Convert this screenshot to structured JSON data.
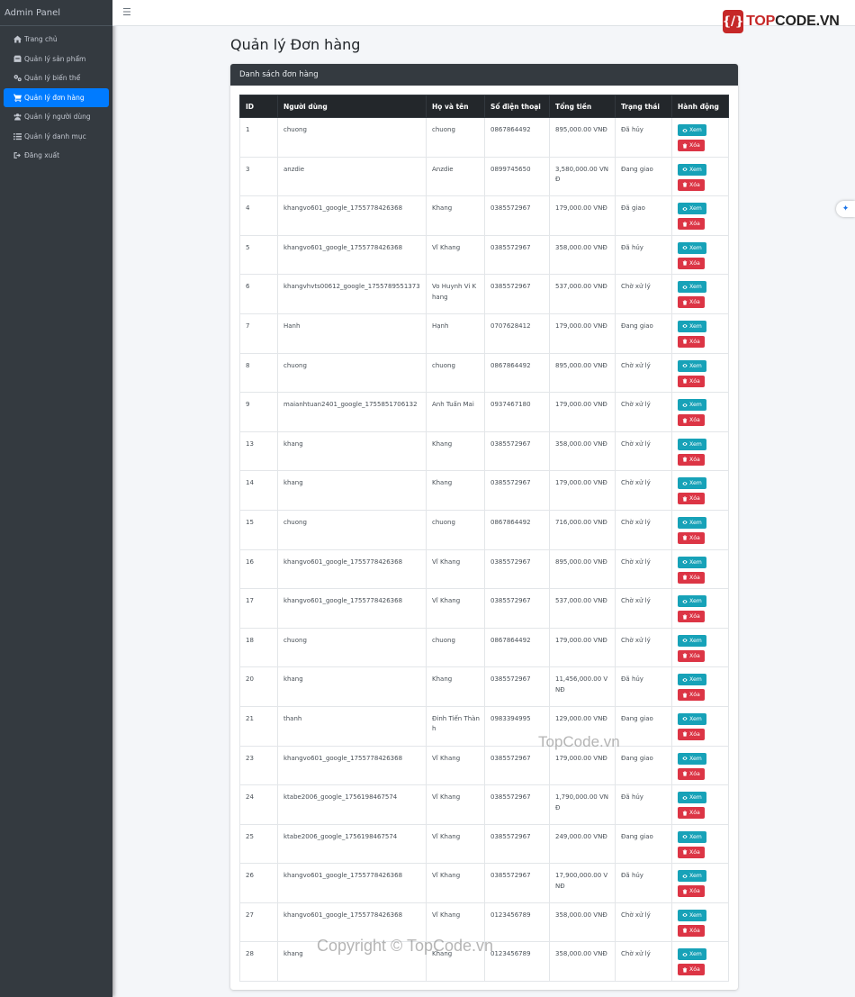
{
  "sidebar": {
    "brand": "Admin Panel",
    "items": [
      {
        "label": "Trang chủ",
        "icon": "home-icon"
      },
      {
        "label": "Quản lý sản phẩm",
        "icon": "box-icon"
      },
      {
        "label": "Quản lý biến thể",
        "icon": "cogs-icon"
      },
      {
        "label": "Quản lý đơn hàng",
        "icon": "cart-icon",
        "active": true
      },
      {
        "label": "Quản lý người dùng",
        "icon": "users-icon"
      },
      {
        "label": "Quản lý danh mục",
        "icon": "list-icon"
      },
      {
        "label": "Đăng xuất",
        "icon": "logout-icon"
      }
    ]
  },
  "topbar": {
    "logo_text_1": "TOP",
    "logo_text_2": "CODE.VN"
  },
  "page": {
    "title": "Quản lý Đơn hàng"
  },
  "card": {
    "header": "Danh sách đơn hàng"
  },
  "table": {
    "columns": [
      "ID",
      "Người dùng",
      "Họ và tên",
      "Số điện thoại",
      "Tổng tiền",
      "Trạng thái",
      "Hành động"
    ],
    "view_label": "Xem",
    "delete_label": "Xóa",
    "rows": [
      [
        "1",
        "chuong",
        "chuong",
        "0867864492",
        "895,000.00 VNĐ",
        "Đã hủy"
      ],
      [
        "3",
        "anzdie",
        "Anzdie",
        "0899745650",
        "3,580,000.00 VNĐ",
        "Đang giao"
      ],
      [
        "4",
        "khangvo601_google_1755778426368",
        "Khang",
        "0385572967",
        "179,000.00 VNĐ",
        "Đã giao"
      ],
      [
        "5",
        "khangvo601_google_1755778426368",
        "Vĩ Khang",
        "0385572967",
        "358,000.00 VNĐ",
        "Đã hủy"
      ],
      [
        "6",
        "khangvhvts00612_google_1755789551373",
        "Vo Huynh Vi Khang",
        "0385572967",
        "537,000.00 VNĐ",
        "Chờ xử lý"
      ],
      [
        "7",
        "Hanh",
        "Hạnh",
        "0707628412",
        "179,000.00 VNĐ",
        "Đang giao"
      ],
      [
        "8",
        "chuong",
        "chuong",
        "0867864492",
        "895,000.00 VNĐ",
        "Chờ xử lý"
      ],
      [
        "9",
        "maianhtuan2401_google_1755851706132",
        "Anh Tuấn Mai",
        "0937467180",
        "179,000.00 VNĐ",
        "Chờ xử lý"
      ],
      [
        "13",
        "khang",
        "Khang",
        "0385572967",
        "358,000.00 VNĐ",
        "Chờ xử lý"
      ],
      [
        "14",
        "khang",
        "Khang",
        "0385572967",
        "179,000.00 VNĐ",
        "Chờ xử lý"
      ],
      [
        "15",
        "chuong",
        "chuong",
        "0867864492",
        "716,000.00 VNĐ",
        "Chờ xử lý"
      ],
      [
        "16",
        "khangvo601_google_1755778426368",
        "Vĩ Khang",
        "0385572967",
        "895,000.00 VNĐ",
        "Chờ xử lý"
      ],
      [
        "17",
        "khangvo601_google_1755778426368",
        "Vĩ Khang",
        "0385572967",
        "537,000.00 VNĐ",
        "Chờ xử lý"
      ],
      [
        "18",
        "chuong",
        "chuong",
        "0867864492",
        "179,000.00 VNĐ",
        "Chờ xử lý"
      ],
      [
        "20",
        "khang",
        "Khang",
        "0385572967",
        "11,456,000.00 VNĐ",
        "Đã hủy"
      ],
      [
        "21",
        "thanh",
        "Đinh Tiến Thành",
        "0983394995",
        "129,000.00 VNĐ",
        "Đang giao"
      ],
      [
        "23",
        "khangvo601_google_1755778426368",
        "Vĩ Khang",
        "0385572967",
        "179,000.00 VNĐ",
        "Đang giao"
      ],
      [
        "24",
        "ktabe2006_google_1756198467574",
        "Vĩ Khang",
        "0385572967",
        "1,790,000.00 VNĐ",
        "Đã hủy"
      ],
      [
        "25",
        "ktabe2006_google_1756198467574",
        "Vĩ Khang",
        "0385572967",
        "249,000.00 VNĐ",
        "Đang giao"
      ],
      [
        "26",
        "khangvo601_google_1755778426368",
        "Vĩ Khang",
        "0385572967",
        "17,900,000.00 VNĐ",
        "Đã hủy"
      ],
      [
        "27",
        "khangvo601_google_1755778426368",
        "Vĩ Khang",
        "0123456789",
        "358,000.00 VNĐ",
        "Chờ xử lý"
      ],
      [
        "28",
        "khang",
        "Khang",
        "0123456789",
        "358,000.00 VNĐ",
        "Chờ xử lý"
      ]
    ]
  },
  "watermarks": {
    "center": "TopCode.vn",
    "bottom": "Copyright © TopCode.vn"
  }
}
